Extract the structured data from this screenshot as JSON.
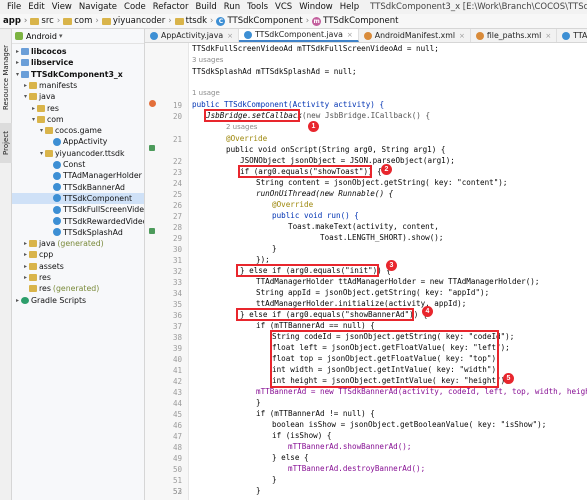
{
  "menu": {
    "items": [
      "File",
      "Edit",
      "View",
      "Navigate",
      "Code",
      "Refactor",
      "Build",
      "Run",
      "Tools",
      "VCS",
      "Window",
      "Help"
    ],
    "window_title": "TTSdkComponent3_x [E:\\Work\\Branch\\COCOS\\TTSdkComponentTest\\build\\android\\proj] - TTSdk"
  },
  "breadcrumb": [
    "app",
    "src",
    "com",
    "yiyuancoder",
    "ttsdk",
    "TTSdkComponent",
    "TTSdkComponent"
  ],
  "left_strip": {
    "resource_manager": "Resource Manager",
    "project": "Project"
  },
  "project_panel": {
    "view_label": "Android",
    "tree": [
      {
        "label": "libcocos",
        "level": 0,
        "arrow": "▸",
        "icon": "module",
        "bold": true
      },
      {
        "label": "libservice",
        "level": 0,
        "arrow": "▸",
        "icon": "module",
        "bold": true
      },
      {
        "label": "TTSdkComponent3_x",
        "level": 0,
        "arrow": "▾",
        "icon": "module",
        "bold": true
      },
      {
        "label": "manifests",
        "level": 1,
        "arrow": "▸",
        "icon": "folder"
      },
      {
        "label": "java",
        "level": 1,
        "arrow": "▾",
        "icon": "folder"
      },
      {
        "label": "res",
        "level": 2,
        "arrow": "▸",
        "icon": "folder"
      },
      {
        "label": "com",
        "level": 2,
        "arrow": "▾",
        "icon": "folder"
      },
      {
        "label": "cocos.game",
        "level": 3,
        "arrow": "▾",
        "icon": "folder"
      },
      {
        "label": "AppActivity",
        "level": 4,
        "arrow": "",
        "icon": "classc"
      },
      {
        "label": "yiyuancoder.ttsdk",
        "level": 3,
        "arrow": "▾",
        "icon": "folder"
      },
      {
        "label": "Const",
        "level": 4,
        "arrow": "",
        "icon": "classc"
      },
      {
        "label": "TTAdManagerHolder",
        "level": 4,
        "arrow": "",
        "icon": "classc"
      },
      {
        "label": "TTSdkBannerAd",
        "level": 4,
        "arrow": "",
        "icon": "classc"
      },
      {
        "label": "TTSdkComponent",
        "level": 4,
        "arrow": "",
        "icon": "classc",
        "selected": true
      },
      {
        "label": "TTSdkFullScreenVideoAd",
        "level": 4,
        "arrow": "",
        "icon": "classc"
      },
      {
        "label": "TTSdkRewardedVideoAd",
        "level": 4,
        "arrow": "",
        "icon": "classc"
      },
      {
        "label": "TTSdkSplashAd",
        "level": 4,
        "arrow": "",
        "icon": "classc"
      },
      {
        "label": "java",
        "level": 1,
        "arrow": "▸",
        "icon": "folder",
        "gen": "(generated)"
      },
      {
        "label": "cpp",
        "level": 1,
        "arrow": "▸",
        "icon": "folder"
      },
      {
        "label": "assets",
        "level": 1,
        "arrow": "▸",
        "icon": "folder"
      },
      {
        "label": "res",
        "level": 1,
        "arrow": "▸",
        "icon": "folder"
      },
      {
        "label": "res",
        "level": 1,
        "arrow": "",
        "icon": "folder",
        "gen": "(generated)"
      },
      {
        "label": "Gradle Scripts",
        "level": 0,
        "arrow": "▸",
        "icon": "gradle"
      }
    ]
  },
  "tabs": [
    {
      "label": "AppActivity.java",
      "color": "#3d8fd4"
    },
    {
      "label": "TTSdkComponent.java",
      "color": "#3d8fd4",
      "active": true
    },
    {
      "label": "AndroidManifest.xml",
      "color": "#d98b3a"
    },
    {
      "label": "file_paths.xml",
      "color": "#d98b3a"
    },
    {
      "label": "TTAdManagerHolder.java",
      "color": "#3d8fd4"
    },
    {
      "label": "TTSdkBannerAd.java",
      "color": "#3d8fd4"
    }
  ],
  "line_numbers": [
    "",
    "",
    "",
    "",
    "",
    "19",
    "20",
    "21",
    "",
    "22",
    "23",
    "24",
    "25",
    "26",
    "27",
    "28",
    "29",
    "30",
    "31",
    "32",
    "33",
    "34",
    "35",
    "36",
    "37",
    "38",
    "39",
    "40",
    "41",
    "42",
    "43",
    "44",
    "45",
    "46",
    "47",
    "48",
    "49",
    "50",
    "51",
    "52",
    "53"
  ],
  "code": {
    "l0": "TTSdkFullScreenVideoAd mTTSdkFullScreenVideoAd = null;",
    "l1": "3 usages",
    "l2": "TTSdkSplashAd mTTSdkSplashAd = null;",
    "l3": "",
    "l4": "1 usage",
    "l5": "public TTSdkComponent(Activity activity) {",
    "l6a": "JsbBridge.setCallback",
    "l6b": "(new JsbBridge.ICallback() {",
    "l7": "2 usages",
    "l8": "@Override",
    "l9": "public void onScript(String arg0, String arg1) {",
    "l10": "JSONObject jsonObject = JSON.parseObject(arg1);",
    "l11": "if (arg0.equals(\"showToast\")) {",
    "l12": "String content = jsonObject.getString( key: \"content\");",
    "l13": "runOnUiThread(new Runnable() {",
    "l14": "@Override",
    "l15": "public void run() {",
    "l16": "Toast.makeText(activity, content,",
    "l17": "Toast.LENGTH_SHORT).show();",
    "l18": "}",
    "l19": "});",
    "l20": "} else if (arg0.equals(\"init\")) {",
    "l21": "TTAdManagerHolder ttAdManagerHolder = new TTAdManagerHolder();",
    "l22": "String appId = jsonObject.getString( key: \"appId\");",
    "l23": "ttAdManagerHolder.initialize(activity, appId);",
    "l24": "} else if (arg0.equals(\"showBannerAd\")) {",
    "l25": "if (mTTBannerAd == null) {",
    "l26": "String codeId = jsonObject.getString( key: \"codeId\");",
    "l27": "float left = jsonObject.getFloatValue( key: \"left\");",
    "l28": "float top = jsonObject.getFloatValue( key: \"top\");",
    "l29": "int width = jsonObject.getIntValue( key: \"width\");",
    "l30": "int height = jsonObject.getIntValue( key: \"height\");",
    "l31": "mTTBannerAd = new TTSdkBannerAd(activity, codeId, left, top, width, height);",
    "l32": "}",
    "l33": "if (mTTBannerAd != null) {",
    "l34": "boolean isShow = jsonObject.getBooleanValue( key: \"isShow\");",
    "l35": "if (isShow) {",
    "l36": "mTTBannerAd.showBannerAd();",
    "l37": "} else {",
    "l38": "mTTBannerAd.destroyBannerAd();",
    "l39": "}",
    "l40": "}"
  },
  "badges": [
    "1",
    "2",
    "3",
    "4",
    "5"
  ],
  "colors": {
    "annotation_red": "#e8262d",
    "selection_blue": "#cfe1f7",
    "keyword": "#0033b3",
    "string": "#067d17",
    "field": "#871094"
  }
}
